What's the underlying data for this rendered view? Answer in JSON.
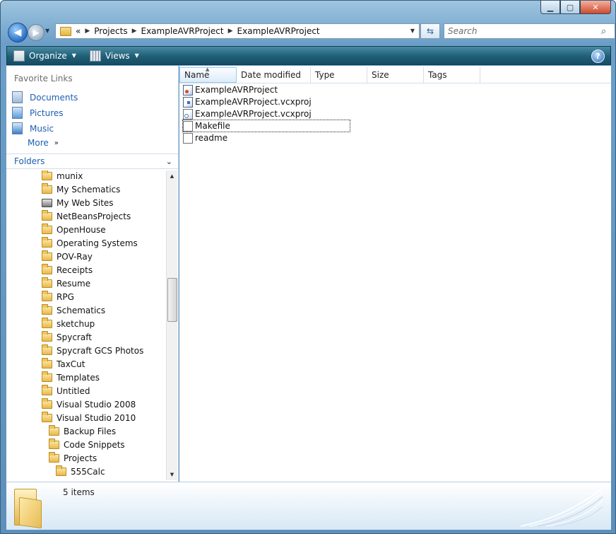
{
  "window": {
    "caption_buttons": [
      "minimize",
      "maximize",
      "close"
    ]
  },
  "navigation": {
    "breadcrumb": [
      "«",
      "Projects",
      "ExampleAVRProject",
      "ExampleAVRProject"
    ],
    "search_placeholder": "Search"
  },
  "toolbar": {
    "organize_label": "Organize",
    "views_label": "Views",
    "help_label": "?"
  },
  "favorites": {
    "title": "Favorite Links",
    "items": [
      {
        "label": "Documents",
        "icon": "documents-icon"
      },
      {
        "label": "Pictures",
        "icon": "pictures-icon"
      },
      {
        "label": "Music",
        "icon": "music-icon"
      }
    ],
    "more_label": "More"
  },
  "folders": {
    "title": "Folders",
    "items": [
      {
        "label": "munix",
        "level": 0,
        "icon": "folder-icon"
      },
      {
        "label": "My Schematics",
        "level": 0,
        "icon": "folder-icon"
      },
      {
        "label": "My Web Sites",
        "level": 0,
        "icon": "web-sites-icon"
      },
      {
        "label": "NetBeansProjects",
        "level": 0,
        "icon": "folder-icon"
      },
      {
        "label": "OpenHouse",
        "level": 0,
        "icon": "folder-icon"
      },
      {
        "label": "Operating Systems",
        "level": 0,
        "icon": "folder-icon"
      },
      {
        "label": "POV-Ray",
        "level": 0,
        "icon": "folder-icon"
      },
      {
        "label": "Receipts",
        "level": 0,
        "icon": "folder-icon"
      },
      {
        "label": "Resume",
        "level": 0,
        "icon": "folder-icon"
      },
      {
        "label": "RPG",
        "level": 0,
        "icon": "folder-icon"
      },
      {
        "label": "Schematics",
        "level": 0,
        "icon": "folder-icon"
      },
      {
        "label": "sketchup",
        "level": 0,
        "icon": "folder-icon"
      },
      {
        "label": "Spycraft",
        "level": 0,
        "icon": "folder-icon"
      },
      {
        "label": "Spycraft GCS Photos",
        "level": 0,
        "icon": "folder-icon"
      },
      {
        "label": "TaxCut",
        "level": 0,
        "icon": "folder-icon"
      },
      {
        "label": "Templates",
        "level": 0,
        "icon": "folder-icon"
      },
      {
        "label": "Untitled",
        "level": 0,
        "icon": "folder-icon"
      },
      {
        "label": "Visual Studio 2008",
        "level": 0,
        "icon": "folder-icon"
      },
      {
        "label": "Visual Studio 2010",
        "level": 0,
        "icon": "folder-icon"
      },
      {
        "label": "Backup Files",
        "level": 1,
        "icon": "folder-icon"
      },
      {
        "label": "Code Snippets",
        "level": 1,
        "icon": "folder-icon"
      },
      {
        "label": "Projects",
        "level": 1,
        "icon": "folder-icon"
      },
      {
        "label": "555Calc",
        "level": 2,
        "icon": "folder-icon"
      }
    ]
  },
  "file_list": {
    "columns": [
      "Name",
      "Date modified",
      "Type",
      "Size",
      "Tags"
    ],
    "sorted_by": "Name",
    "files": [
      {
        "name": "ExampleAVRProject",
        "icon": "solution-file-icon"
      },
      {
        "name": "ExampleAVRProject.vcxproj",
        "icon": "project-file-icon"
      },
      {
        "name": "ExampleAVRProject.vcxproj",
        "icon": "user-file-icon"
      },
      {
        "name": "Makefile",
        "icon": "document-icon",
        "focused": true
      },
      {
        "name": "readme",
        "icon": "text-file-icon"
      }
    ]
  },
  "details": {
    "item_count": "5 items"
  },
  "colors": {
    "link_blue": "#1c5eb3",
    "toolbar_teal": "#1f5e77"
  }
}
